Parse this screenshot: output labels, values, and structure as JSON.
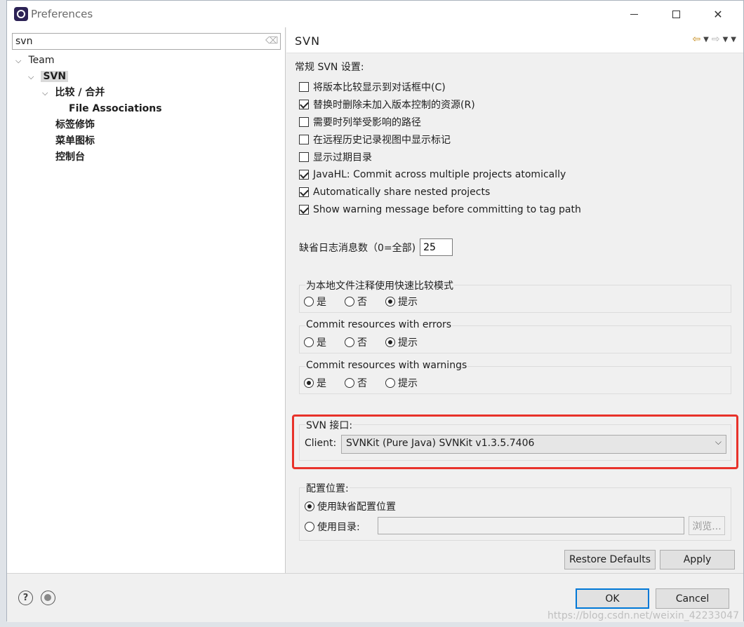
{
  "window": {
    "title": "Preferences"
  },
  "search": {
    "value": "svn"
  },
  "tree": {
    "team": "Team",
    "svn": "SVN",
    "compare_merge": "比较 / 合并",
    "file_associations": "File Associations",
    "label_decorations": "标签修饰",
    "menu_icons": "菜单图标",
    "console": "控制台"
  },
  "page": {
    "title": "SVN",
    "general_label": "常规 SVN 设置:",
    "checkboxes": [
      {
        "label": "将版本比较显示到对话框中(C)",
        "checked": false
      },
      {
        "label": "替换时删除未加入版本控制的资源(R)",
        "checked": true
      },
      {
        "label": "需要时列举受影响的路径",
        "checked": false
      },
      {
        "label": "在远程历史记录视图中显示标记",
        "checked": false
      },
      {
        "label": "显示过期目录",
        "checked": false
      },
      {
        "label": "JavaHL: Commit across multiple projects atomically",
        "checked": true
      },
      {
        "label": "Automatically share nested projects",
        "checked": true
      },
      {
        "label": "Show warning message before committing to tag path",
        "checked": true
      }
    ],
    "log_label": "缺省日志消息数（0=全部)",
    "log_value": "25",
    "groups": [
      {
        "legend": "为本地文件注释使用快速比较模式",
        "options": [
          "是",
          "否",
          "提示"
        ],
        "selected": 2
      },
      {
        "legend": "Commit resources with errors",
        "options": [
          "是",
          "否",
          "提示"
        ],
        "selected": 2
      },
      {
        "legend": "Commit resources with warnings",
        "options": [
          "是",
          "否",
          "提示"
        ],
        "selected": 0
      }
    ],
    "svn_interface": {
      "legend": "SVN 接口:",
      "client_label": "Client:",
      "client_value": "SVNKit (Pure Java) SVNKit v1.3.5.7406"
    },
    "config_location": {
      "legend": "配置位置:",
      "use_default": "使用缺省配置位置",
      "use_directory": "使用目录:",
      "browse": "浏览...",
      "selected": 0
    },
    "restore_defaults": "Restore Defaults",
    "apply": "Apply"
  },
  "footer": {
    "ok": "OK",
    "cancel": "Cancel",
    "watermark": "https://blog.csdn.net/weixin_42233047"
  },
  "colors": {
    "highlight": "#e8322a",
    "default_button_border": "#0078d7"
  }
}
